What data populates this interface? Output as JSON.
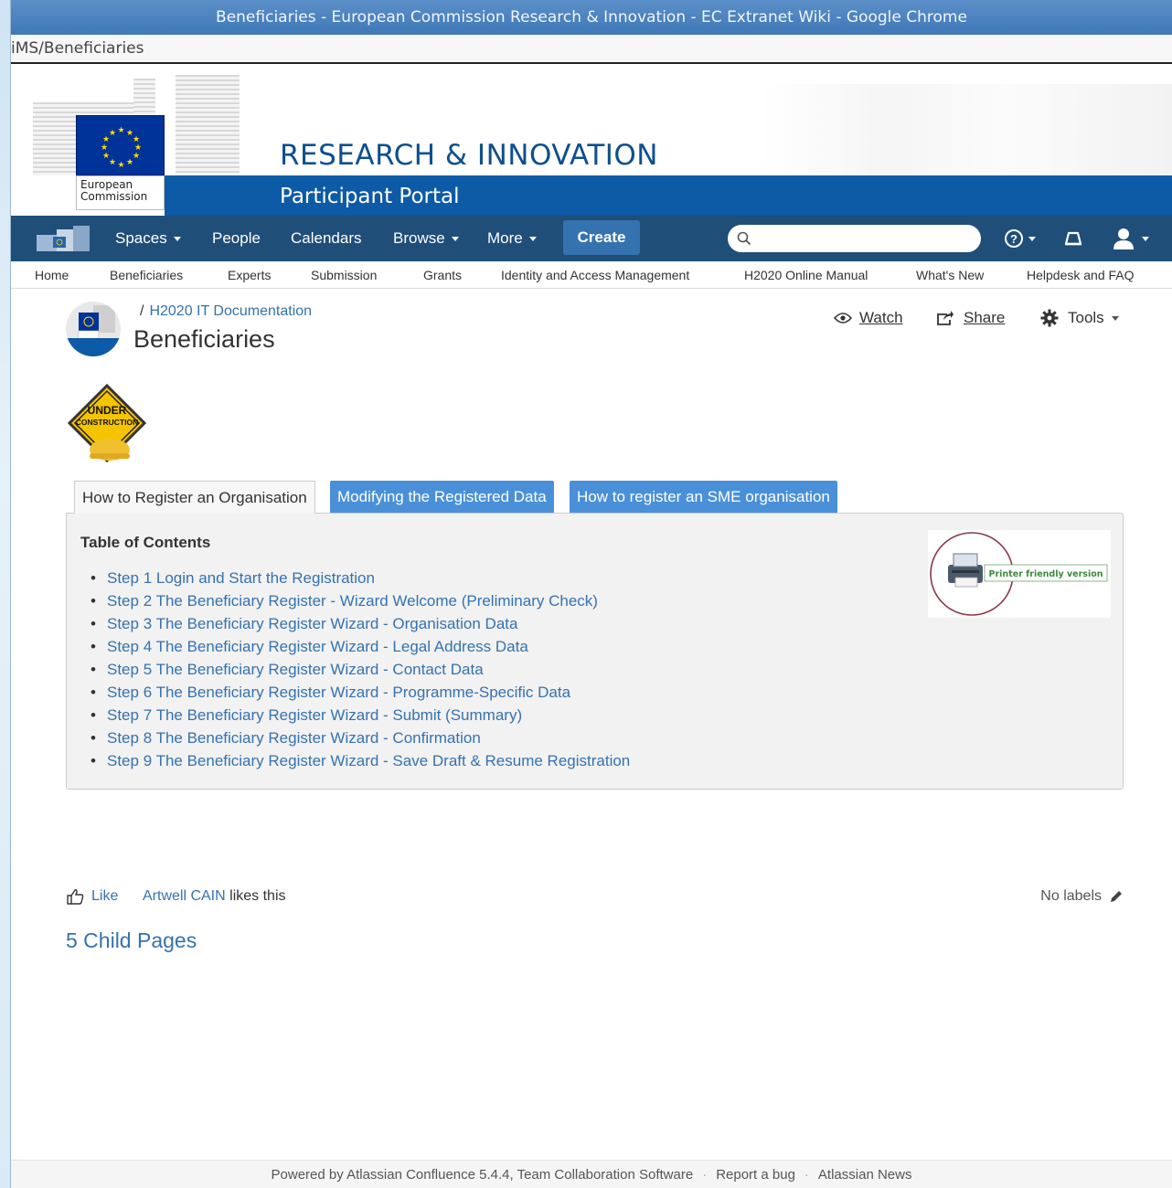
{
  "window": {
    "title": "Beneficiaries - European Commission Research & Innovation - EC Extranet Wiki - Google Chrome",
    "url_fragment": "iMS/Beneficiaries"
  },
  "banner": {
    "ec_label_line1": "European",
    "ec_label_line2": "Commission",
    "title": "RESEARCH & INNOVATION",
    "subtitle": "Participant Portal"
  },
  "nav": {
    "spaces": "Spaces",
    "people": "People",
    "calendars": "Calendars",
    "browse": "Browse",
    "more": "More",
    "create": "Create",
    "search_placeholder": "",
    "search_icon": "search-icon",
    "help_icon": "help-icon",
    "notifications_icon": "notifications-icon",
    "user_icon": "user-icon"
  },
  "submenu": [
    "Home",
    "Beneficiaries",
    "Experts",
    "Submission",
    "Grants",
    "Identity and Access Management",
    "H2020 Online Manual",
    "What's New",
    "Helpdesk and FAQ"
  ],
  "page": {
    "breadcrumb_sep": "/",
    "breadcrumb": "H2020 IT Documentation",
    "title": "Beneficiaries",
    "actions": {
      "watch": "Watch",
      "share": "Share",
      "tools": "Tools"
    },
    "under_construction_line1": "UNDER",
    "under_construction_line2": "CONSTRUCTION"
  },
  "tabs": [
    {
      "label": "How to Register an Organisation",
      "active": true
    },
    {
      "label": "Modifying the Registered Data",
      "active": false
    },
    {
      "label": "How to register an SME organisation",
      "active": false
    }
  ],
  "toc": {
    "title": "Table of Contents",
    "items": [
      "Step 1 Login and Start the Registration",
      "Step 2 The Beneficiary Register - Wizard Welcome (Preliminary Check)",
      "Step 3 The Beneficiary Register Wizard - Organisation Data",
      "Step 4 The Beneficiary Register Wizard - Legal Address Data",
      "Step 5 The Beneficiary Register Wizard - Contact Data",
      "Step 6 The Beneficiary Register Wizard - Programme-Specific Data",
      "Step 7 The Beneficiary Register Wizard - Submit (Summary)",
      "Step 8 The Beneficiary Register Wizard - Confirmation",
      "Step 9 The Beneficiary Register Wizard - Save Draft & Resume Registration"
    ],
    "printer_label": "Printer friendly version"
  },
  "social": {
    "like": "Like",
    "liker": "Artwell CAIN",
    "likes_suffix": "likes this",
    "labels": "No labels"
  },
  "child_pages": "5 Child Pages",
  "footer": {
    "powered": "Powered by Atlassian Confluence 5.4.4, Team Collaboration Software",
    "report": "Report a bug",
    "news": "Atlassian News"
  },
  "colors": {
    "nav_bg": "#1f4e79",
    "link": "#3572b0",
    "tab_inactive": "#4a90d9",
    "ec_blue": "#0d5aa7"
  }
}
